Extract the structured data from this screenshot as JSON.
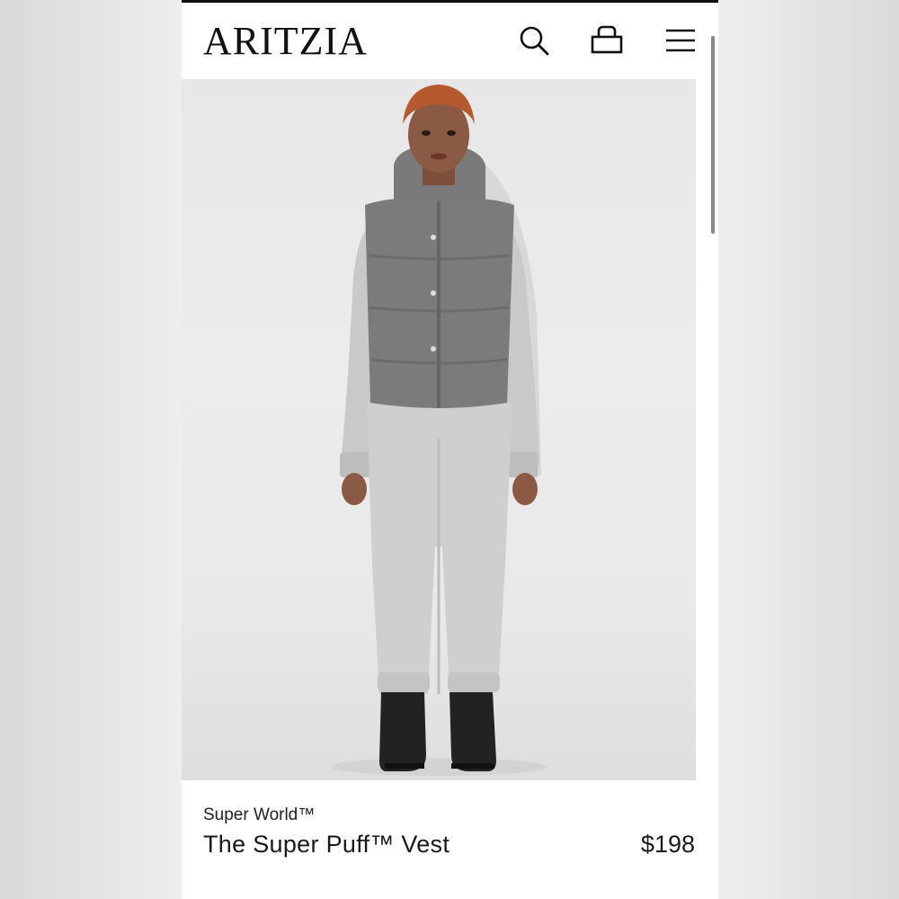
{
  "header": {
    "logo": "ARITZIA",
    "icons": [
      "search-icon",
      "bag-icon",
      "menu-icon"
    ]
  },
  "product": {
    "brand": "Super World™",
    "name": "The Super Puff™ Vest",
    "price": "$198"
  },
  "colors": {
    "text": "#111111",
    "header_bg": "#ffffff",
    "hero_bg": "#e9e9e9",
    "page_bg": "#ececec"
  }
}
